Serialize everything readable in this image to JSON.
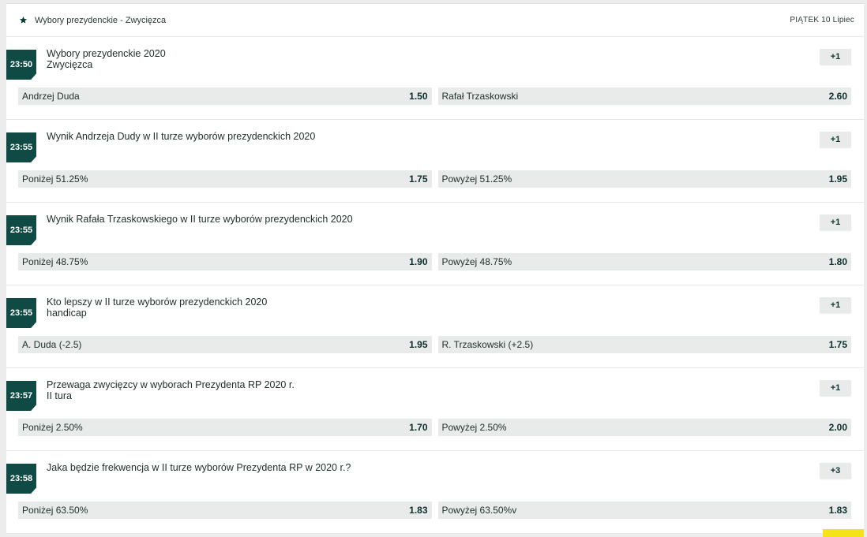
{
  "header": {
    "title": "Wybory prezydenckie - Zwycięzca",
    "date": "PIĄTEK 10 Lipiec"
  },
  "events": [
    {
      "time": "23:50",
      "title": "Wybory prezydenckie 2020\nZwycięzca",
      "more": "+1",
      "odds": [
        {
          "label": "Andrzej Duda",
          "value": "1.50"
        },
        {
          "label": "Rafał Trzaskowski",
          "value": "2.60"
        }
      ]
    },
    {
      "time": "23:55",
      "title": "Wynik Andrzeja Dudy w II turze wyborów prezydenckich 2020",
      "more": "+1",
      "odds": [
        {
          "label": "Poniżej 51.25%",
          "value": "1.75"
        },
        {
          "label": "Powyżej 51.25%",
          "value": "1.95"
        }
      ]
    },
    {
      "time": "23:55",
      "title": "Wynik Rafała Trzaskowskiego w II turze wyborów prezydenckich 2020",
      "more": "+1",
      "odds": [
        {
          "label": "Poniżej 48.75%",
          "value": "1.90"
        },
        {
          "label": "Powyżej 48.75%",
          "value": "1.80"
        }
      ]
    },
    {
      "time": "23:55",
      "title": "Kto lepszy w II turze wyborów prezydenckich 2020\nhandicap",
      "more": "+1",
      "odds": [
        {
          "label": "A. Duda (-2.5)",
          "value": "1.95"
        },
        {
          "label": "R. Trzaskowski (+2.5)",
          "value": "1.75"
        }
      ]
    },
    {
      "time": "23:57",
      "title": "Przewaga zwycięzcy w wyborach Prezydenta RP 2020 r.\nII tura",
      "more": "+1",
      "odds": [
        {
          "label": "Poniżej 2.50%",
          "value": "1.70"
        },
        {
          "label": "Powyżej 2.50%",
          "value": "2.00"
        }
      ]
    },
    {
      "time": "23:58",
      "title": "Jaka będzie frekwencja w II turze wyborów Prezydenta RP w 2020 r.?",
      "more": "+3",
      "odds": [
        {
          "label": "Poniżej 63.50%",
          "value": "1.83"
        },
        {
          "label": "Powyżej 63.50%v",
          "value": "1.83"
        }
      ]
    }
  ],
  "colors": {
    "accent": "#0f4a44",
    "odds_bg": "#e8ebea",
    "highlight": "#f5e31a"
  }
}
